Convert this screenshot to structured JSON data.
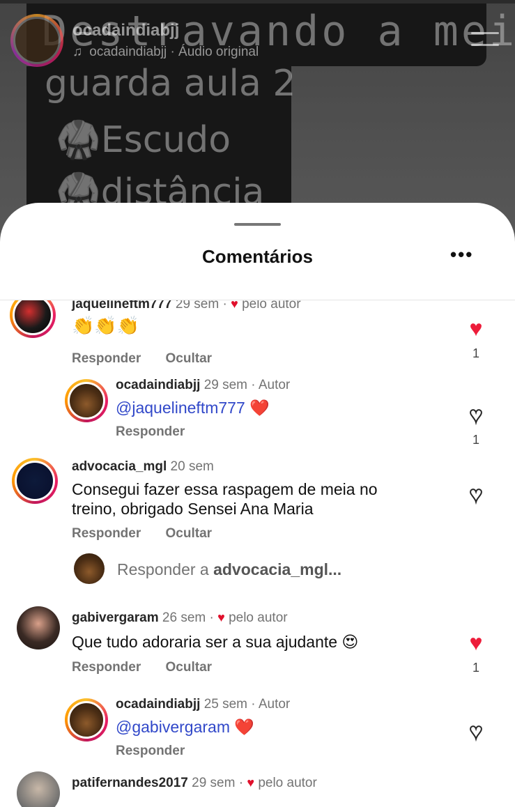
{
  "video": {
    "overlay_lines": [
      "Destravando a meia",
      "guarda aula 2",
      "🥋Escudo",
      "🥋distância"
    ],
    "account": "ocadaindiabjj",
    "audio": "ocadaindiabjj · Áudio original",
    "audio_icon": "music-note-icon"
  },
  "sheet": {
    "title": "Comentários",
    "more_icon": "•••"
  },
  "comments": [
    {
      "user": "jaquelineftm777",
      "time": "29 sem ·",
      "author_like": "pelo autor",
      "text": "👏👏👏",
      "reply_label": "Responder",
      "hide_label": "Ocultar",
      "liked": true,
      "likes": "1",
      "reply": {
        "user": "ocadaindiabjj",
        "meta": "29 sem · Autor",
        "mention": "@jaquelineftm777",
        "text": " ❤️",
        "reply_label": "Responder",
        "liked": false,
        "likes": "1"
      }
    },
    {
      "user": "advocacia_mgl",
      "time": "20 sem",
      "text_line1": "Consegui fazer essa raspagem de meia no",
      "text_line2": "treino, obrigado Sensei Ana Maria",
      "reply_label": "Responder",
      "hide_label": "Ocultar",
      "liked": false,
      "reply_placeholder": "Responder a ",
      "reply_placeholder_user": "advocacia_mgl..."
    },
    {
      "user": "gabivergaram",
      "time": "26 sem ·",
      "author_like": "pelo autor",
      "text": "Que tudo adoraria ser a sua ajudante 😍",
      "reply_label": "Responder",
      "hide_label": "Ocultar",
      "liked": true,
      "likes": "1",
      "reply": {
        "user": "ocadaindiabjj",
        "meta": "25 sem · Autor",
        "mention": "@gabivergaram",
        "text": " ❤️",
        "reply_label": "Responder",
        "liked": false
      }
    },
    {
      "user": "patifernandes2017",
      "time": "29 sem ·",
      "author_like": "pelo autor"
    }
  ],
  "colors": {
    "like_red": "#ed1c3a",
    "mention_blue": "#3148c9",
    "muted_text": "#737373"
  }
}
